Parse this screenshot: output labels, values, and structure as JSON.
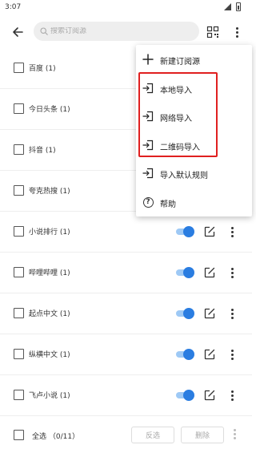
{
  "status_bar": {
    "time": "3:07"
  },
  "toolbar": {
    "search_placeholder": "搜索订阅源"
  },
  "rows": [
    {
      "label": "百度 (1)"
    },
    {
      "label": "今日头条 (1)"
    },
    {
      "label": "抖音 (1)"
    },
    {
      "label": "夸克热搜 (1)"
    },
    {
      "label": "小说排行 (1)"
    },
    {
      "label": "哔哩哔哩 (1)"
    },
    {
      "label": "起点中文 (1)"
    },
    {
      "label": "纵横中文 (1)"
    },
    {
      "label": "飞卢小说 (1)"
    }
  ],
  "bottom_bar": {
    "select_all": "全选 （0/11）",
    "invert": "反选",
    "delete": "删除"
  },
  "menu": {
    "items": [
      {
        "label": "新建订阅源",
        "icon": "plus-icon"
      },
      {
        "label": "本地导入",
        "icon": "import-icon"
      },
      {
        "label": "网络导入",
        "icon": "import-icon"
      },
      {
        "label": "二维码导入",
        "icon": "import-icon"
      },
      {
        "label": "导入默认规则",
        "icon": "import-icon"
      },
      {
        "label": "帮助",
        "icon": "help-icon"
      }
    ]
  },
  "colors": {
    "accent": "#2a7de1",
    "highlight": "#e02020"
  }
}
